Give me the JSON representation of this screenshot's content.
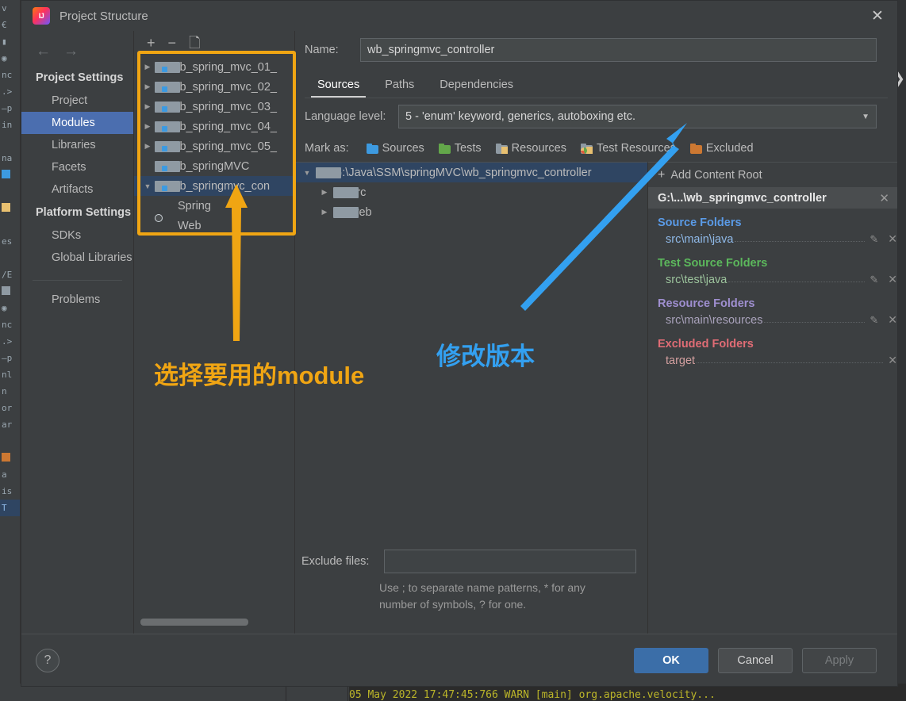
{
  "window": {
    "title": "Project Structure",
    "app_icon": "intellij-idea-icon",
    "close_icon": "close-icon"
  },
  "nav": {
    "back_icon": "arrow-left-icon",
    "forward_icon": "arrow-right-icon",
    "groups": [
      {
        "label": "Project Settings",
        "items": [
          {
            "label": "Project",
            "selected": false
          },
          {
            "label": "Modules",
            "selected": true
          },
          {
            "label": "Libraries",
            "selected": false
          },
          {
            "label": "Facets",
            "selected": false
          },
          {
            "label": "Artifacts",
            "selected": false
          }
        ]
      },
      {
        "label": "Platform Settings",
        "items": [
          {
            "label": "SDKs",
            "selected": false
          },
          {
            "label": "Global Libraries",
            "selected": false
          }
        ]
      }
    ],
    "problems": "Problems"
  },
  "modules_panel": {
    "toolbar": {
      "add": "+",
      "remove": "−",
      "copy_icon": "copy-icon"
    },
    "items": [
      {
        "label": "wb_spring_mvc_01_",
        "expandable": true,
        "expanded": false,
        "icon": "module-folder-icon",
        "indent": 0,
        "selected": false
      },
      {
        "label": "wb_spring_mvc_02_",
        "expandable": true,
        "expanded": false,
        "icon": "module-folder-icon",
        "indent": 0,
        "selected": false
      },
      {
        "label": "wb_spring_mvc_03_",
        "expandable": true,
        "expanded": false,
        "icon": "module-folder-icon",
        "indent": 0,
        "selected": false
      },
      {
        "label": "wb_spring_mvc_04_",
        "expandable": true,
        "expanded": false,
        "icon": "module-folder-icon",
        "indent": 0,
        "selected": false
      },
      {
        "label": "wb_spring_mvc_05_",
        "expandable": true,
        "expanded": false,
        "icon": "module-folder-icon",
        "indent": 0,
        "selected": false
      },
      {
        "label": "wb_springMVC",
        "expandable": false,
        "expanded": false,
        "icon": "module-folder-icon",
        "indent": 0,
        "selected": false
      },
      {
        "label": "wb_springmvc_con",
        "expandable": true,
        "expanded": true,
        "icon": "module-folder-icon",
        "indent": 0,
        "selected": true
      },
      {
        "label": "Spring",
        "expandable": false,
        "expanded": false,
        "icon": "spring-facet-icon",
        "indent": 1,
        "selected": false
      },
      {
        "label": "Web",
        "expandable": false,
        "expanded": false,
        "icon": "web-facet-icon",
        "indent": 1,
        "selected": false
      }
    ]
  },
  "editor": {
    "name_label": "Name:",
    "name_value": "wb_springmvc_controller",
    "tabs": [
      {
        "label": "Sources",
        "active": true
      },
      {
        "label": "Paths",
        "active": false
      },
      {
        "label": "Dependencies",
        "active": false
      }
    ],
    "language_level_label": "Language level:",
    "language_level_value": "5 - 'enum' keyword, generics, autoboxing etc.",
    "language_level_caret": "chevron-down-icon",
    "mark_as_label": "Mark as:",
    "mark_as": [
      {
        "label": "Sources",
        "icon": "sources-folder-icon",
        "color": "#3d9ae0"
      },
      {
        "label": "Tests",
        "icon": "tests-folder-icon",
        "color": "#63a74a"
      },
      {
        "label": "Resources",
        "icon": "resources-folder-icon",
        "color": "#8f9aa3"
      },
      {
        "label": "Test Resources",
        "icon": "test-resources-folder-icon",
        "color": "#8f9aa3"
      },
      {
        "label": "Excluded",
        "icon": "excluded-folder-icon",
        "color": "#cc7832"
      }
    ],
    "tree": [
      {
        "label": "G:\\Java\\SSM\\springMVC\\wb_springmvc_controller",
        "indent": 0,
        "expanded": true,
        "selected": true
      },
      {
        "label": "src",
        "indent": 1,
        "expanded": false,
        "selected": false
      },
      {
        "label": "web",
        "indent": 1,
        "expanded": false,
        "selected": false
      }
    ],
    "exclude_files_label": "Exclude files:",
    "exclude_files_value": "",
    "exclude_hint_line1": "Use ; to separate name patterns, * for any",
    "exclude_hint_line2": "number of symbols, ? for one."
  },
  "roots_panel": {
    "add_content_root": "Add Content Root",
    "add_icon": "plus-icon",
    "content_root": "G:\\...\\wb_springmvc_controller",
    "content_root_close_icon": "close-icon",
    "groups": [
      {
        "title": "Source Folders",
        "color": "#5a9ae6",
        "items": [
          {
            "path": "src\\main\\java",
            "edit_icon": "pencil-icon",
            "remove_icon": "close-icon"
          }
        ]
      },
      {
        "title": "Test Source Folders",
        "color": "#5cb85c",
        "items": [
          {
            "path": "src\\test\\java",
            "edit_icon": "pencil-icon",
            "remove_icon": "close-icon"
          }
        ]
      },
      {
        "title": "Resource Folders",
        "color": "#9f8fd0",
        "items": [
          {
            "path": "src\\main\\resources",
            "edit_icon": "pencil-icon",
            "remove_icon": "close-icon"
          }
        ]
      },
      {
        "title": "Excluded Folders",
        "color": "#e06c75",
        "items": [
          {
            "path": "target",
            "edit_icon": "",
            "remove_icon": "close-icon"
          }
        ]
      }
    ]
  },
  "footer": {
    "help_icon": "question-mark-icon",
    "ok": "OK",
    "cancel": "Cancel",
    "apply": "Apply"
  },
  "annotations": [
    {
      "id": "module-callout",
      "text": "选择要用的module",
      "color": "#f0a513"
    },
    {
      "id": "version-callout",
      "text": "修改版本",
      "color": "#33a0f0"
    }
  ],
  "annotation_colors": {
    "orange": "#f0a513",
    "blue": "#33a0f0"
  },
  "backdrop": {
    "console_line": "05 May 2022 17:47:45:766 WARN [main] org.apache.velocity...",
    "chevron_icon": "chevron-right-icon"
  }
}
